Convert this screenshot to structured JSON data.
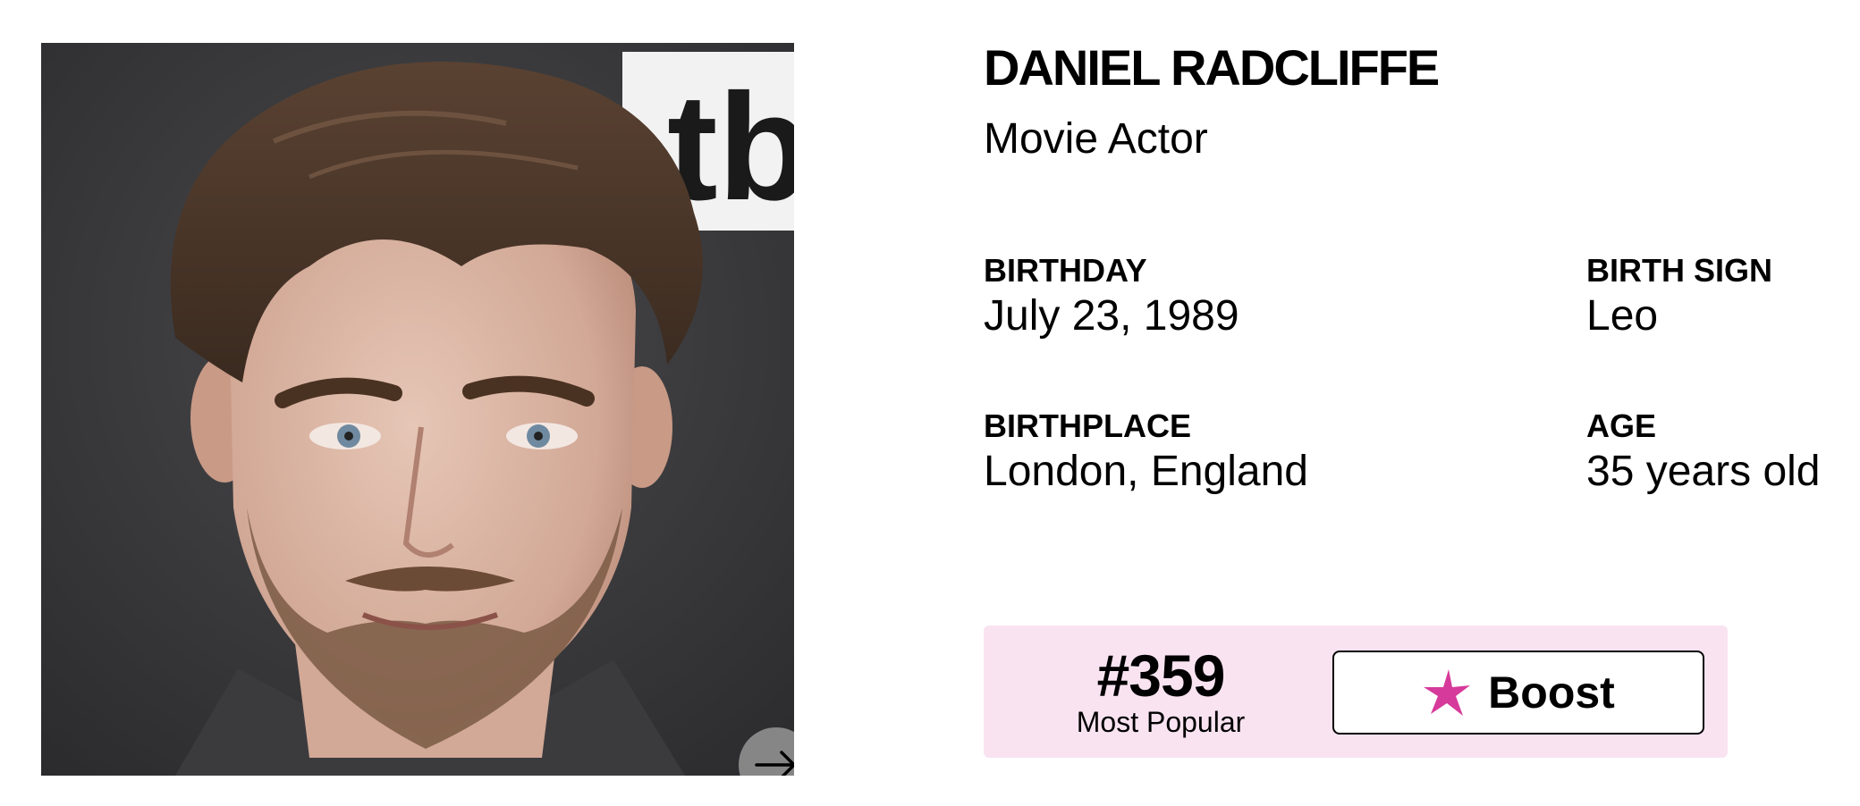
{
  "celebrity": {
    "name": "DANIEL RADCLIFFE",
    "occupation": "Movie Actor"
  },
  "facts": {
    "birthday": {
      "label": "BIRTHDAY",
      "value": "July 23, 1989"
    },
    "birth_sign": {
      "label": "BIRTH SIGN",
      "value": "Leo"
    },
    "birthplace": {
      "label": "BIRTHPLACE",
      "value": "London, England"
    },
    "age": {
      "label": "AGE",
      "value": "35 years old"
    }
  },
  "popularity": {
    "rank": "#359",
    "caption": "Most Popular",
    "boost_label": "Boost"
  },
  "photo": {
    "next_icon": "arrow-right-icon",
    "backdrop_logo_text": "tb"
  },
  "colors": {
    "panel_background": "#f9e3f1",
    "star_accent": "#d63a9a",
    "text": "#000000"
  }
}
